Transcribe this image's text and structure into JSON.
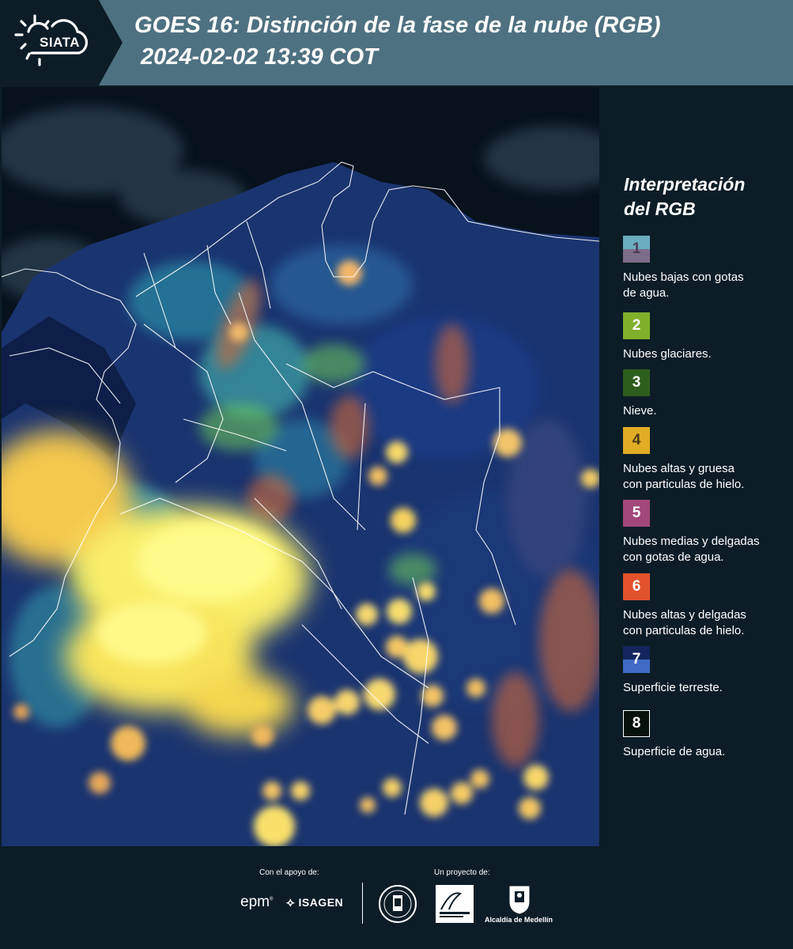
{
  "header": {
    "logo_text": "SIATA",
    "title_line1": "GOES 16: Distinción de la fase de la nube (RGB)",
    "title_line2": "2024-02-02 13:39 COT"
  },
  "legend": {
    "title_line1": "Interpretación",
    "title_line2": "del RGB",
    "items": [
      {
        "number": "1",
        "label_lines": [
          "Nubes bajas con gotas",
          "de agua."
        ],
        "color_top": "#6aaec0",
        "color_bottom": "#7e6d8a",
        "text_color": "#4a3f5a"
      },
      {
        "number": "2",
        "label_lines": [
          "Nubes glaciares."
        ],
        "color_top": "#7fb02c",
        "color_bottom": "#7fb02c",
        "text_color": "#ffffff"
      },
      {
        "number": "3",
        "label_lines": [
          "Nieve."
        ],
        "color_top": "#2e5e1c",
        "color_bottom": "#2e5e1c",
        "text_color": "#ffffff"
      },
      {
        "number": "4",
        "label_lines": [
          "Nubes altas y gruesa",
          "con particulas de hielo."
        ],
        "color_top": "#e1ad24",
        "color_bottom": "#e1ad24",
        "text_color": "#4a3a10"
      },
      {
        "number": "5",
        "label_lines": [
          "Nubes medias y delgadas",
          "con gotas de agua."
        ],
        "color_top": "#a24779",
        "color_bottom": "#a24779",
        "text_color": "#ffffff"
      },
      {
        "number": "6",
        "label_lines": [
          "Nubes altas y delgadas",
          "con particulas de hielo."
        ],
        "color_top": "#e2522b",
        "color_bottom": "#e2522b",
        "text_color": "#ffffff"
      },
      {
        "number": "7",
        "label_lines": [
          "Superficie terreste."
        ],
        "color_top": "#14255e",
        "color_bottom": "#3f6bc4",
        "text_color": "#ffffff"
      },
      {
        "number": "8",
        "label_lines": [
          "Superficie de agua."
        ],
        "color_top": "#08120c",
        "color_bottom": "#08120c",
        "text_color": "#ffffff"
      }
    ]
  },
  "footer": {
    "support_label": "Con el apoyo de:",
    "project_label": "Un proyecto de:",
    "sponsor_1": "epm",
    "sponsor_2": "ISAGEN",
    "partner_3": "Alcaldía de Medellín"
  }
}
